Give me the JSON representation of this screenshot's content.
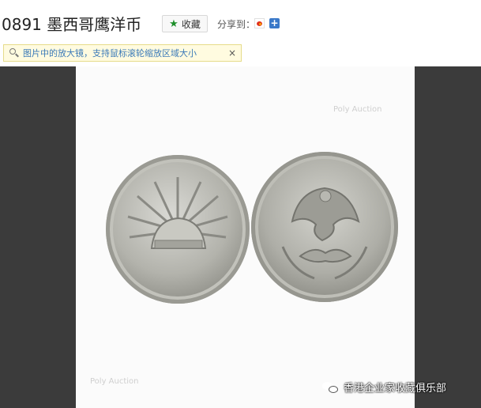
{
  "header": {
    "title": "0891 墨西哥鹰洋币",
    "favorite_label": "收藏",
    "share_label": "分享到：",
    "share_icons": [
      "weibo-icon",
      "plus-icon"
    ]
  },
  "tip": {
    "text": "图片中的放大镜，支持鼠标滚轮缩放区域大小",
    "close_symbol": "×"
  },
  "image": {
    "watermark_top": "Poly Auction",
    "watermark_bottom": "Poly Auction",
    "caption": "香港企业家收藏俱乐部"
  },
  "colors": {
    "viewer_background": "#3b3b3b",
    "photo_background": "#fbfbfb",
    "tip_background": "#fffbe0",
    "tip_text": "#3b7ab8",
    "favorite_star": "#1d8f2a"
  }
}
